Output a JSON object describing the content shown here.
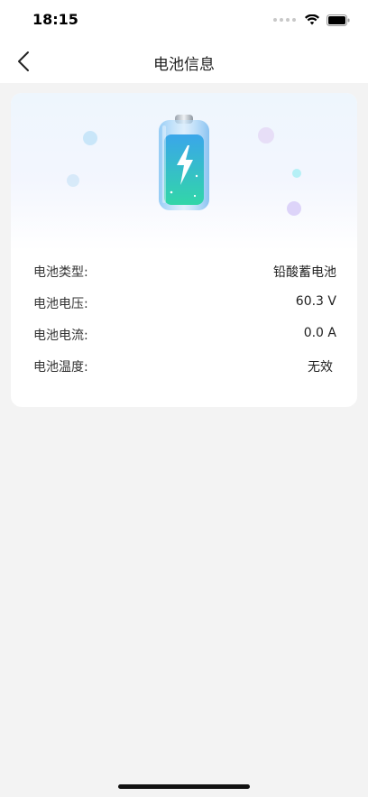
{
  "status_bar": {
    "time": "18:15"
  },
  "header": {
    "title": "电池信息",
    "back_icon": "chevron-left-icon"
  },
  "battery_info": {
    "rows": [
      {
        "label": "电池类型:",
        "value": "铅酸蓄电池"
      },
      {
        "label": "电池电压:",
        "value": "60.3 V"
      },
      {
        "label": "电池电流:",
        "value": "0.0 A"
      },
      {
        "label": "电池温度:",
        "value": "无效"
      }
    ]
  },
  "colors": {
    "background": "#f3f3f3",
    "card": "#ffffff",
    "battery_liquid_top": "#3aa6ea",
    "battery_liquid_bottom": "#32d6a8"
  }
}
